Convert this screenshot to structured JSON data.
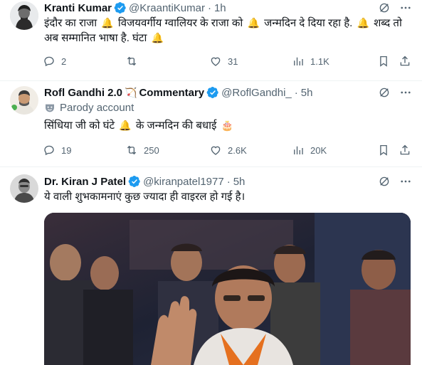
{
  "tweets": [
    {
      "name": "Kranti Kumar",
      "handle": "@KraantiKumar",
      "time": "1h",
      "text_parts": [
        "इंदौर का राजा",
        "विजयवर्गीय ग्वालियर के राजा को",
        "जन्मदिन दे दिया रहा है.",
        "शब्द तो",
        "अब सम्मानित भाषा है. घंटा"
      ],
      "bell": "🔔",
      "replies": "2",
      "reposts": "",
      "likes": "31",
      "views": "1.1K"
    },
    {
      "name": "Rofl Gandhi 2.0",
      "name_emoji": "🏹",
      "name_suffix": "Commentary",
      "handle": "@RoflGandhi_",
      "time": "5h",
      "parody_label": "Parody account",
      "text_parts": [
        "सिंधिया जी को घंटे",
        "के जन्मदिन की बधाई"
      ],
      "bell": "🔔",
      "cake": "🎂",
      "replies": "19",
      "reposts": "250",
      "likes": "2.6K",
      "views": "20K"
    },
    {
      "name": "Dr. Kiran J Patel",
      "handle": "@kiranpatel1977",
      "time": "5h",
      "text": "ये वाली शुभकामनाएं कुछ ज्यादा ही वाइरल हो गई है।"
    }
  ],
  "separator": "·",
  "colors": {
    "verified": "#1d9bf0",
    "muted": "#536471",
    "text": "#0f1419"
  },
  "icons": [
    "verified-icon",
    "grok-icon",
    "more-icon",
    "reply-icon",
    "repost-icon",
    "like-icon",
    "views-icon",
    "bookmark-icon",
    "share-icon",
    "parody-icon"
  ]
}
